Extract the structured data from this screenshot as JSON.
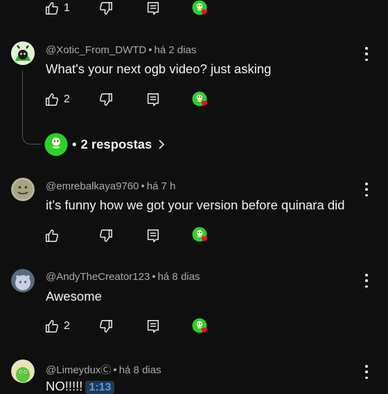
{
  "top_partial": {
    "like_count": "1"
  },
  "comments": [
    {
      "handle": "@Xotic_From_DWTD",
      "time": "há 2 dias",
      "text": "What's your next ogb video? just asking",
      "like_count": "2"
    },
    {
      "handle": "@emrebalkaya9760",
      "time": "há 7 h",
      "text": "it’s funny how we got your version before quinara did",
      "like_count": ""
    },
    {
      "handle": "@AndyTheCreator123",
      "time": "há 8 dias",
      "text": "Awesome",
      "like_count": "2"
    },
    {
      "handle": "@LimeyduxⒸ",
      "time": "há 8 dias",
      "text": "NO!!!!!",
      "timestamp_link": "1:13"
    }
  ],
  "replies": {
    "separator": "•",
    "label": "2 respostas"
  },
  "colors": {
    "background": "#0f0f0f",
    "text": "#f1f1f1",
    "meta": "#aaaaaa",
    "heart": "#ff0033",
    "creator_avatar": "#2ad12a",
    "link": "#3ea6ff"
  },
  "icons": {
    "like": "thumbs-up-icon",
    "dislike": "thumbs-down-icon",
    "reply": "comment-reply-icon",
    "menu": "more-vert-icon",
    "heart": "creator-heart-icon",
    "chevron": "chevron-right-icon"
  }
}
